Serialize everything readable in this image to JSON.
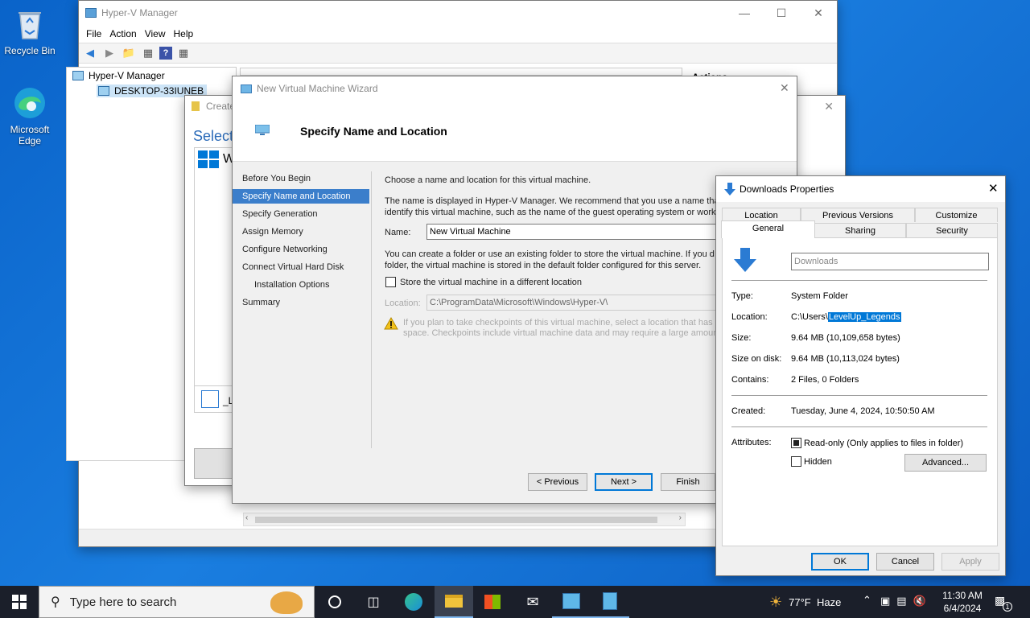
{
  "desktop": {
    "icons": [
      {
        "label": "Recycle Bin",
        "icon": "recycle-bin-icon"
      },
      {
        "label": "Microsoft Edge",
        "icon": "edge-icon"
      }
    ]
  },
  "hyperv": {
    "title": "Hyper-V Manager",
    "menu": [
      "File",
      "Action",
      "View",
      "Help"
    ],
    "tree_root": "Hyper-V Manager",
    "tree_child": "DESKTOP-33IUNEB",
    "actions_header": "Actions"
  },
  "bg_wizard": {
    "title": "Create",
    "heading": "Select",
    "item_letter": "W",
    "bottom_letter": "_L"
  },
  "wizard": {
    "title": "New Virtual Machine Wizard",
    "heading": "Specify Name and Location",
    "nav": [
      "Before You Begin",
      "Specify Name and Location",
      "Specify Generation",
      "Assign Memory",
      "Configure Networking",
      "Connect Virtual Hard Disk",
      "Installation Options",
      "Summary"
    ],
    "intro": "Choose a name and location for this virtual machine.",
    "desc_line1": "The name is displayed in Hyper-V Manager. We recommend that you use a name that",
    "desc_line2": "identify this virtual machine, such as the name of the guest operating system or work",
    "name_label": "Name:",
    "name_value": "New Virtual Machine",
    "folder_line1": "You can create a folder or use an existing folder to store the virtual machine. If you d",
    "folder_line2": "folder, the virtual machine is stored in the default folder configured for this server.",
    "store_checkbox": "Store the virtual machine in a different location",
    "location_label": "Location:",
    "location_value": "C:\\ProgramData\\Microsoft\\Windows\\Hyper-V\\",
    "warn_line1": "If you plan to take checkpoints of this virtual machine, select a location that has",
    "warn_line2": "space. Checkpoints include virtual machine data and may require a large amount",
    "btn_previous": "< Previous",
    "btn_next": "Next >",
    "btn_finish": "Finish"
  },
  "props": {
    "title": "Downloads Properties",
    "tabs_row1": [
      "Location",
      "Previous Versions",
      "Customize"
    ],
    "tabs_row2": [
      "General",
      "Sharing",
      "Security"
    ],
    "folder_name": "Downloads",
    "type_label": "Type:",
    "type_value": "System Folder",
    "location_label": "Location:",
    "location_prefix": "C:\\Users\\",
    "location_selected": "LevelUp_Legends",
    "size_label": "Size:",
    "size_value": "9.64 MB (10,109,658 bytes)",
    "size_disk_label": "Size on disk:",
    "size_disk_value": "9.64 MB (10,113,024 bytes)",
    "contains_label": "Contains:",
    "contains_value": "2 Files, 0 Folders",
    "created_label": "Created:",
    "created_value": "Tuesday, June 4, 2024, 10:50:50 AM",
    "attributes_label": "Attributes:",
    "readonly_label": "Read-only (Only applies to files in folder)",
    "hidden_label": "Hidden",
    "advanced_btn": "Advanced...",
    "ok_btn": "OK",
    "cancel_btn": "Cancel",
    "apply_btn": "Apply"
  },
  "taskbar": {
    "search_placeholder": "Type here to search",
    "weather": "77°F  Haze",
    "time": "11:30 AM",
    "date": "6/4/2024",
    "notification_count": "1"
  }
}
